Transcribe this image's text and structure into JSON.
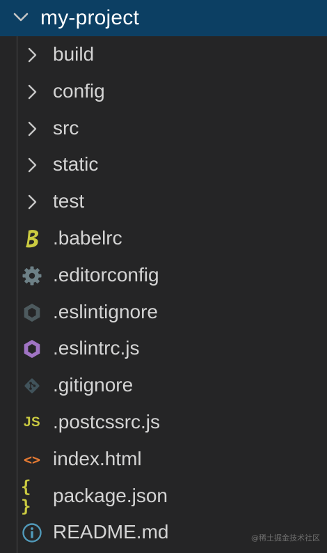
{
  "header": {
    "title": "my-project",
    "background": "#0c3f63"
  },
  "tree": [
    {
      "label": "build",
      "type": "folder",
      "icon": "chevron-right-icon"
    },
    {
      "label": "config",
      "type": "folder",
      "icon": "chevron-right-icon"
    },
    {
      "label": "src",
      "type": "folder",
      "icon": "chevron-right-icon"
    },
    {
      "label": "static",
      "type": "folder",
      "icon": "chevron-right-icon"
    },
    {
      "label": "test",
      "type": "folder",
      "icon": "chevron-right-icon"
    },
    {
      "label": ".babelrc",
      "type": "file",
      "icon": "babel-icon",
      "icon_color": "#cbcb41"
    },
    {
      "label": ".editorconfig",
      "type": "file",
      "icon": "gear-icon",
      "icon_color": "#6d8086"
    },
    {
      "label": ".eslintignore",
      "type": "file",
      "icon": "eslint-ignore-icon",
      "icon_color": "#4d5a5e"
    },
    {
      "label": ".eslintrc.js",
      "type": "file",
      "icon": "eslint-icon",
      "icon_color": "#a074c4"
    },
    {
      "label": ".gitignore",
      "type": "file",
      "icon": "git-icon",
      "icon_color": "#41535b"
    },
    {
      "label": ".postcssrc.js",
      "type": "file",
      "icon": "javascript-icon",
      "icon_text": "JS",
      "icon_color": "#cbcb41"
    },
    {
      "label": "index.html",
      "type": "file",
      "icon": "html-icon",
      "icon_text": "<>",
      "icon_color": "#e37933"
    },
    {
      "label": "package.json",
      "type": "file",
      "icon": "json-icon",
      "icon_text": "{ }",
      "icon_color": "#cbcb41"
    },
    {
      "label": "README.md",
      "type": "file",
      "icon": "info-icon",
      "icon_color": "#519aba"
    }
  ],
  "watermark": "@稀土掘金技术社区",
  "colors": {
    "sidebar_bg": "#252526",
    "text": "#d4d4d4",
    "chevron": "#c5c5c5"
  }
}
